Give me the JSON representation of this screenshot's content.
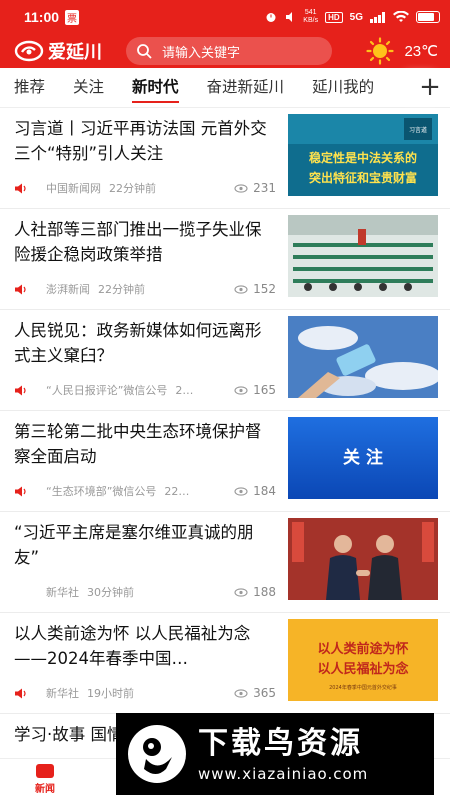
{
  "status_bar": {
    "time": "11:00",
    "carrier_badge": "票",
    "network_speed": "541\nKB/s",
    "hd": "HD",
    "signal": "5G",
    "battery": ""
  },
  "header": {
    "logo_text": "爱延川",
    "search_placeholder": "请输入关键字",
    "temperature": "23℃"
  },
  "tabs": [
    "推荐",
    "关注",
    "新时代",
    "奋进新延川",
    "延川我的"
  ],
  "active_tab": 2,
  "feed": [
    {
      "title": "习言道丨习近平再访法国 元首外交三个“特别”引人关注",
      "source": "中国新闻网",
      "time": "22分钟前",
      "views": "231",
      "thumb_text_1": "稳定性是中法关系的",
      "thumb_text_2": "突出特征和宝贵财富",
      "thumb_badge": "习言道"
    },
    {
      "title": "人社部等三部门推出一揽子失业保险援企稳岗政策举措",
      "source": "澎湃新闻",
      "time": "22分钟前",
      "views": "152"
    },
    {
      "title": "人民锐见：政务新媒体如何远离形式主义窠臼？",
      "source": "“人民日报评论”微信公号",
      "time": "2…",
      "views": "165"
    },
    {
      "title": "第三轮第二批中央生态环境保护督察全面启动",
      "source": "“生态环境部”微信公号",
      "time": "22…",
      "views": "184",
      "thumb_text_1": "关 注"
    },
    {
      "title": "“习近平主席是塞尔维亚真诚的朋友”",
      "source": "新华社",
      "time": "30分钟前",
      "views": "188"
    },
    {
      "title": "以人类前途为怀 以人民福祉为念——2024年春季中国…",
      "source": "新华社",
      "time": "19小时前",
      "views": "365",
      "thumb_text_1": "以人类前途为怀",
      "thumb_text_2": "以人民福祉为念",
      "thumb_text_3": "2024年春季中国元首外交纪事"
    },
    {
      "title": "学习·故事 国情缘 习近",
      "source": "",
      "time": "",
      "views": ""
    }
  ],
  "bottom_nav": [
    {
      "label": "新闻",
      "active": true
    },
    {
      "label": "",
      "active": false
    },
    {
      "label": "",
      "active": false
    },
    {
      "label": "",
      "active": false
    },
    {
      "label": "",
      "active": false
    }
  ],
  "watermark": {
    "cn": "下载鸟资源",
    "url": "www.xiazainiao.com"
  },
  "colors": {
    "brand": "#e6211b",
    "meta_text": "#999999"
  },
  "icons": [
    "logo-icon",
    "search-icon",
    "sun-icon",
    "add-tab-icon",
    "speaker-icon",
    "eye-icon"
  ]
}
